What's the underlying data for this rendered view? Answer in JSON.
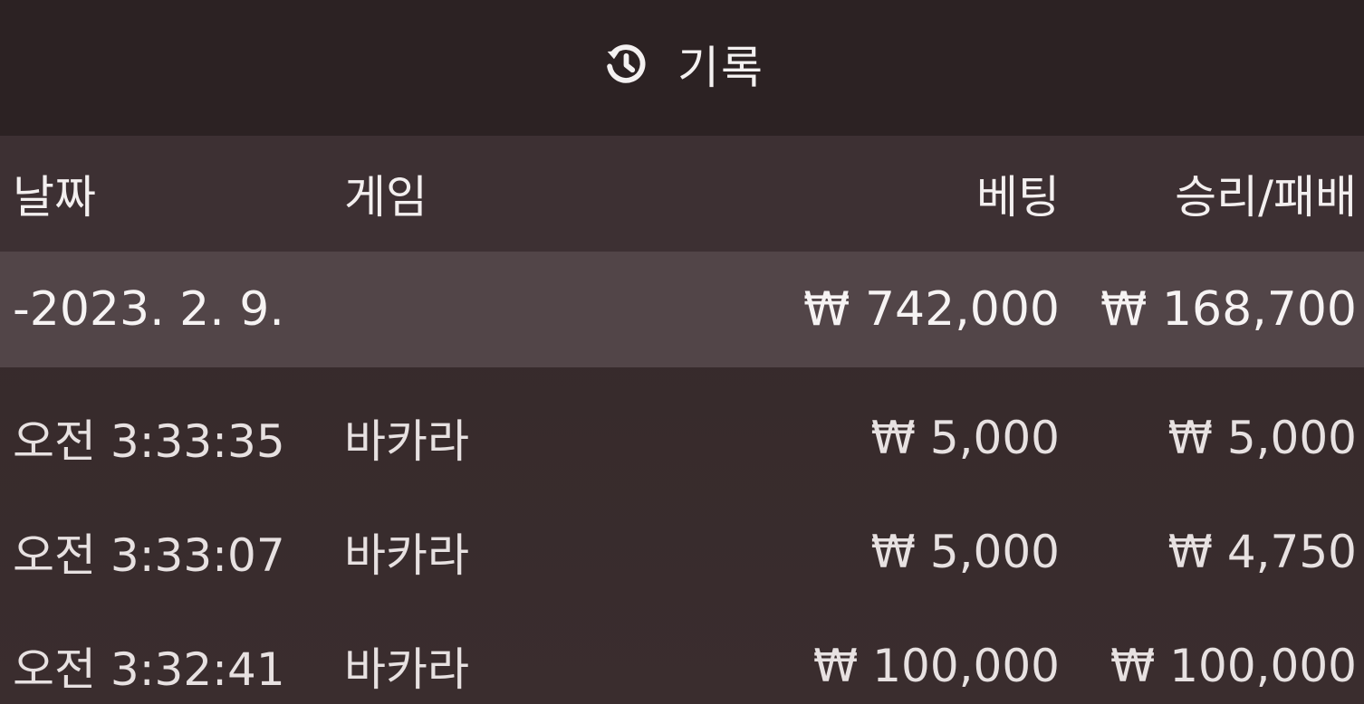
{
  "header": {
    "title": "기록",
    "icon": "history-icon"
  },
  "columns": {
    "date": "날짜",
    "game": "게임",
    "bet": "베팅",
    "result": "승리/패배"
  },
  "summary": {
    "date": "-2023. 2. 9.",
    "bet": "₩ 742,000",
    "result": "₩ 168,700"
  },
  "records": [
    {
      "time": "오전 3:33:35",
      "game": "바카라",
      "bet": "₩ 5,000",
      "result": "₩ 5,000"
    },
    {
      "time": "오전 3:33:07",
      "game": "바카라",
      "bet": "₩ 5,000",
      "result": "₩ 4,750"
    },
    {
      "time": "오전 3:32:41",
      "game": "바카라",
      "bet": "₩ 100,000",
      "result": "₩ 100,000"
    }
  ],
  "colors": {
    "header_bg": "#2c2223",
    "column_header_bg": "#3d3033",
    "summary_bg": "#524548",
    "text": "#f2eeee"
  }
}
